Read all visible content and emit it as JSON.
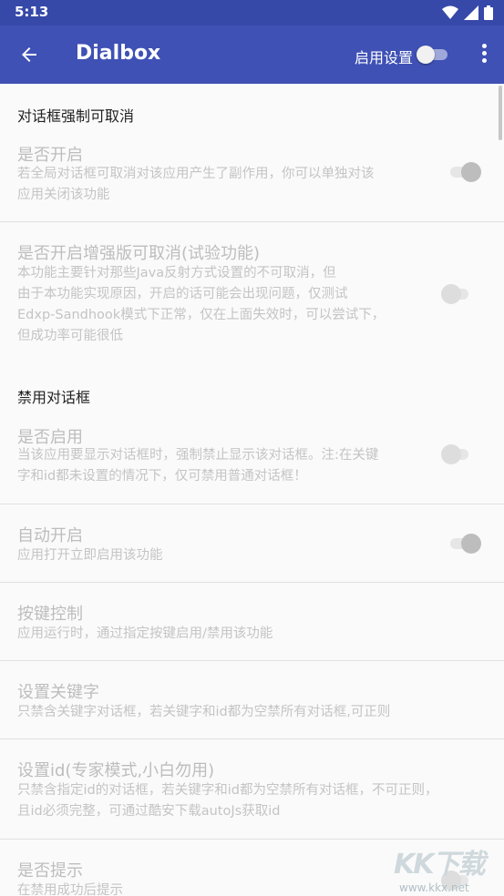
{
  "status_bar": {
    "time": "5:13"
  },
  "app_bar": {
    "title": "Dialbox",
    "enable_label": "启用设置"
  },
  "sections": [
    {
      "category": "对话框强制可取消",
      "prefs": [
        {
          "title": "是否开启",
          "summary_lines": [
            "若全局对话框可取消对该应用产生了副作用，你可以单独对该",
            "应用关闭该功能"
          ],
          "switch": "on"
        },
        {
          "title": "是否开启增强版可取消(试验功能)",
          "summary_lines": [
            "本功能主要针对那些Java反射方式设置的不可取消，但",
            "由于本功能实现原因，开启的话可能会出现问题，仅测试",
            "Edxp-Sandhook模式下正常，仅在上面失效时，可以尝试下，",
            "但成功率可能很低"
          ],
          "switch": "off"
        }
      ]
    },
    {
      "category": "禁用对话框",
      "prefs": [
        {
          "title": "是否启用",
          "summary_lines": [
            "当该应用要显示对话框时，强制禁止显示该对话框。注:在关键",
            "字和id都未设置的情况下，仅可禁用普通对话框！"
          ],
          "switch": "off"
        },
        {
          "title": "自动开启",
          "summary_lines": [
            "应用打开立即启用该功能"
          ],
          "switch": "on"
        },
        {
          "title": "按键控制",
          "summary_lines": [
            "应用运行时，通过指定按键启用/禁用该功能"
          ]
        },
        {
          "title": "设置关键字",
          "summary_lines": [
            "只禁含关键字对话框，若关键字和id都为空禁所有对话框,可正则"
          ]
        },
        {
          "title": "设置id(专家模式,小白勿用)",
          "summary_lines": [
            "只禁含指定id的对话框，若关键字和id都为空禁所有对话框，不可正则，",
            "且id必须完整，可通过酷安下载autoJs获取id"
          ]
        },
        {
          "title": "是否提示",
          "summary_lines": [
            "在禁用成功后提示"
          ],
          "switch": "off"
        }
      ]
    }
  ],
  "watermark": {
    "text": "KK下载",
    "url": "www.kkx.net"
  }
}
